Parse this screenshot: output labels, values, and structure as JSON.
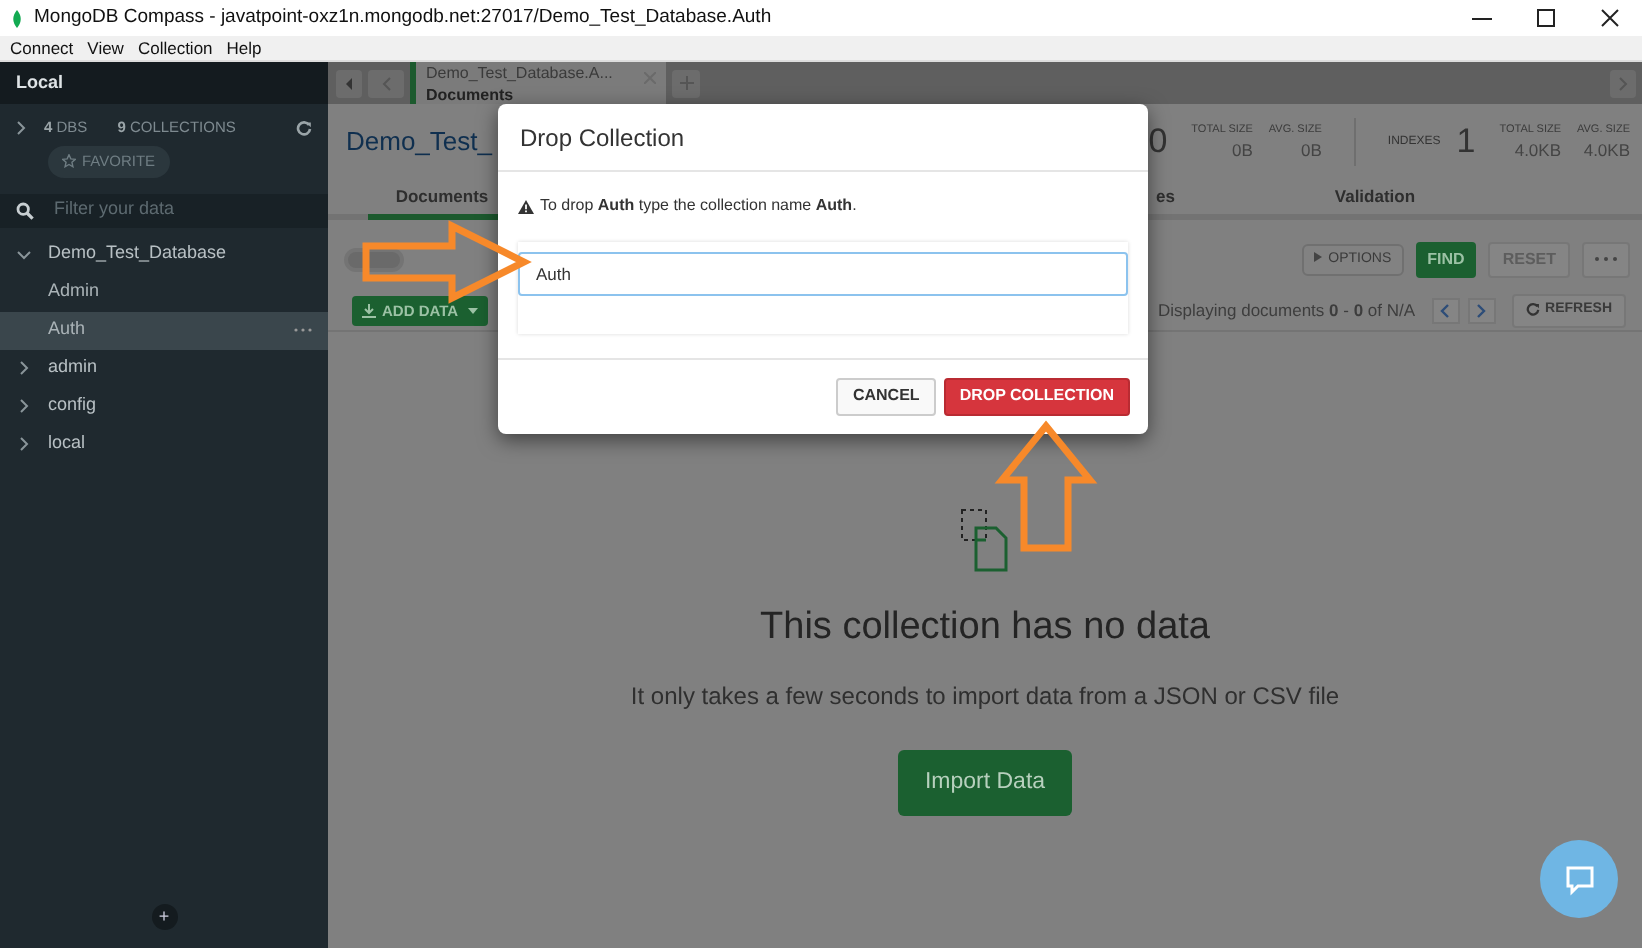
{
  "window": {
    "title": "MongoDB Compass - javatpoint-oxz1n.mongodb.net:27017/Demo_Test_Database.Auth"
  },
  "menu": [
    "Connect",
    "View",
    "Collection",
    "Help"
  ],
  "sidebar": {
    "header": "Local",
    "dbs_count": "4",
    "dbs_label": "DBS",
    "collections_count": "9",
    "collections_label": "COLLECTIONS",
    "favorite": "FAVORITE",
    "filter_placeholder": "Filter your data",
    "databases": [
      {
        "name": "Demo_Test_Database",
        "expanded": true,
        "children": [
          {
            "name": "Admin",
            "selected": false
          },
          {
            "name": "Auth",
            "selected": true
          }
        ]
      },
      {
        "name": "admin",
        "expanded": false
      },
      {
        "name": "config",
        "expanded": false
      },
      {
        "name": "local",
        "expanded": false
      }
    ],
    "add_button": "+"
  },
  "tab": {
    "title": "Demo_Test_Database.A...",
    "subtitle": "Documents"
  },
  "collection_header": {
    "title": "Demo_Test_",
    "documents_count": "0",
    "stats": [
      {
        "label": "TOTAL SIZE",
        "value": "0B"
      },
      {
        "label": "AVG. SIZE",
        "value": "0B"
      }
    ],
    "indexes_label": "INDEXES",
    "indexes_count": "1",
    "index_stats": [
      {
        "label": "TOTAL SIZE",
        "value": "4.0KB"
      },
      {
        "label": "AVG. SIZE",
        "value": "4.0KB"
      }
    ]
  },
  "view_tabs": [
    {
      "label": "Documents",
      "selected": true
    },
    {
      "label": "es",
      "selected": false
    },
    {
      "label": "Validation",
      "selected": false
    }
  ],
  "query_bar": {
    "filter_toggle": {
      "on": false
    },
    "options": "OPTIONS",
    "find": "FIND",
    "reset": "RESET"
  },
  "toolbar": {
    "add_data": "ADD DATA",
    "summary": "Displaying documents **0** - **0** of N/A",
    "refresh": "REFRESH"
  },
  "empty_state": {
    "heading": "This collection has no data",
    "text": "It only takes a few seconds to import data from a JSON or CSV file",
    "button": "Import Data"
  },
  "modal": {
    "title": "Drop Collection",
    "message": "To drop **Auth** type the collection name **Auth**.",
    "input_value": "Auth",
    "buttons": [
      {
        "label": "CANCEL",
        "kind": "secondary"
      },
      {
        "label": "DROP COLLECTION",
        "kind": "danger"
      }
    ]
  }
}
